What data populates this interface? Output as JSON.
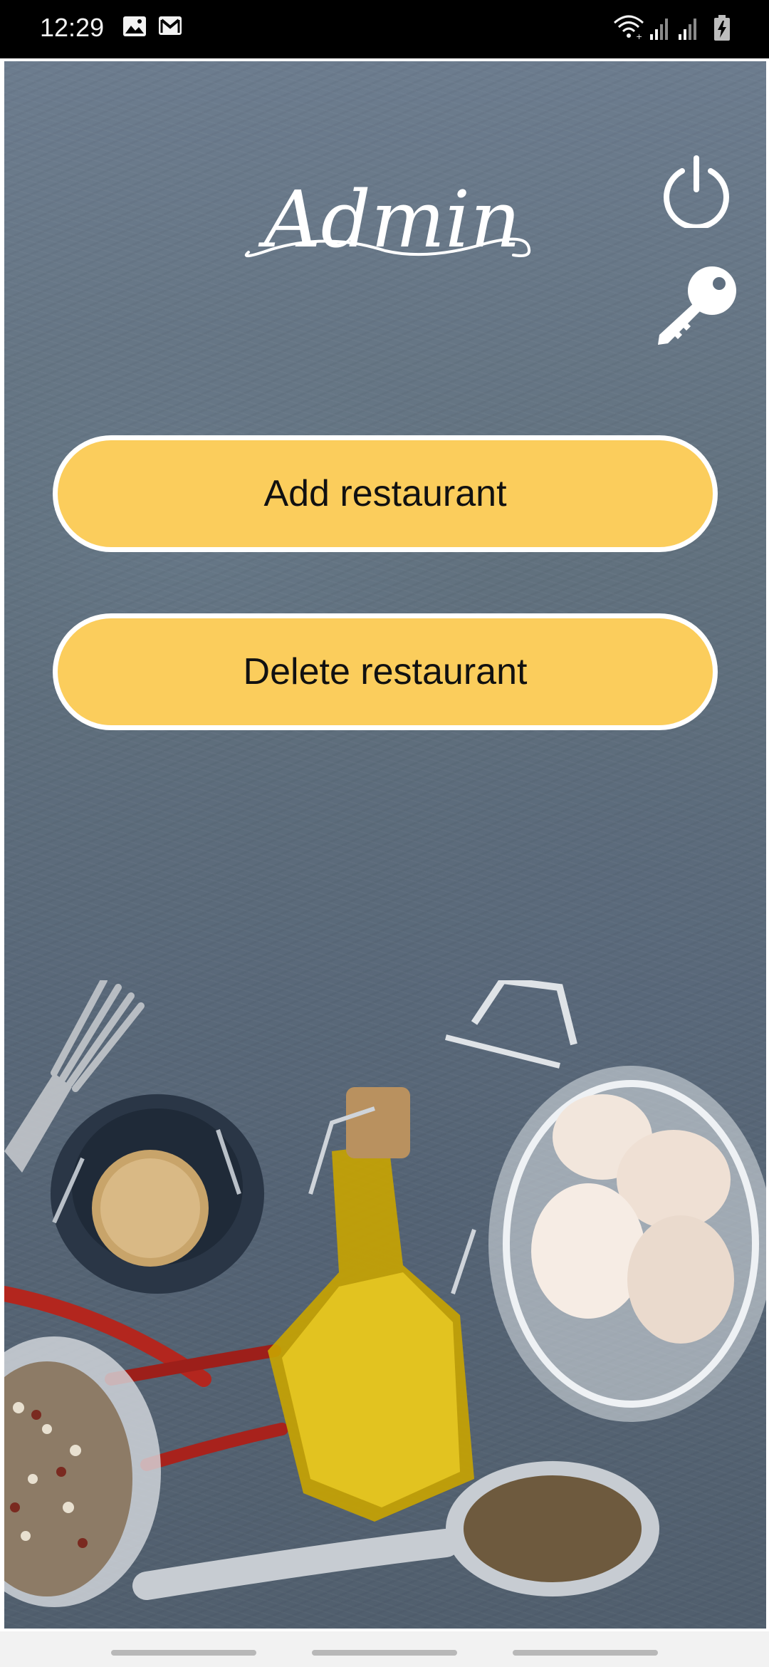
{
  "status_bar": {
    "time": "12:29",
    "left_icons": [
      "image-icon",
      "gmail-icon"
    ],
    "right_icons": [
      "wifi-icon",
      "signal-icon",
      "signal-icon",
      "battery-charging-icon"
    ]
  },
  "header": {
    "title": "Admin",
    "power_icon": "power-icon",
    "key_icon": "key-icon"
  },
  "actions": {
    "add_label": "Add restaurant",
    "delete_label": "Delete restaurant"
  },
  "colors": {
    "button_fill": "#fbcd5c",
    "button_border": "#ffffff",
    "background": "#5d6d7d"
  },
  "nav_bar": {
    "items": [
      "nav-pill-left",
      "nav-pill-center",
      "nav-pill-right"
    ]
  }
}
